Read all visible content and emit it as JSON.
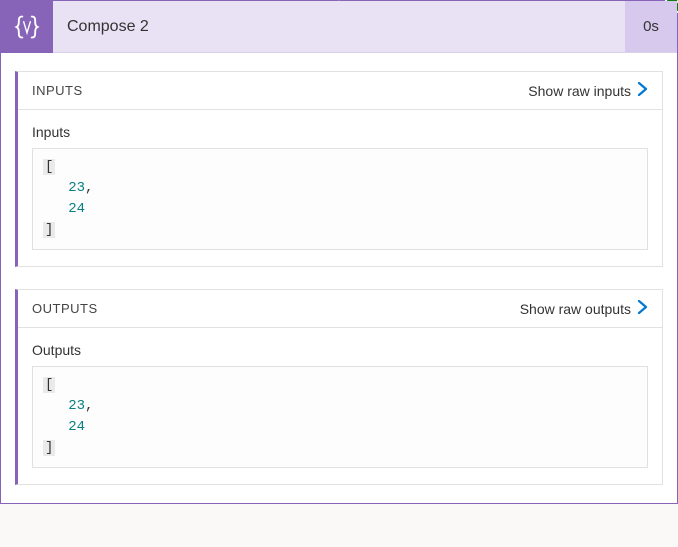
{
  "card": {
    "title": "Compose 2",
    "duration": "0s",
    "iconName": "braces-icon"
  },
  "inputs": {
    "sectionLabel": "INPUTS",
    "rawLink": "Show raw inputs",
    "bodyLabel": "Inputs",
    "values": [
      23,
      24
    ]
  },
  "outputs": {
    "sectionLabel": "OUTPUTS",
    "rawLink": "Show raw outputs",
    "bodyLabel": "Outputs",
    "values": [
      23,
      24
    ]
  }
}
